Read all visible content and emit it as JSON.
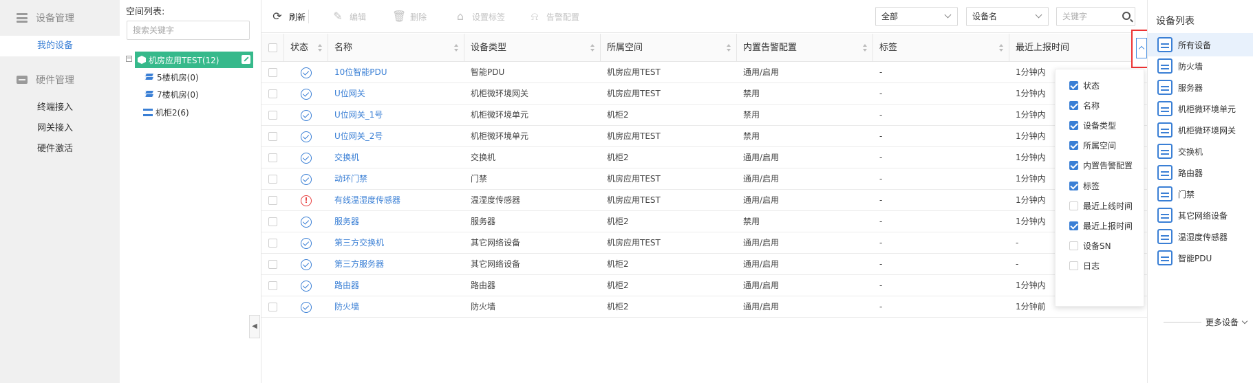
{
  "leftnav": {
    "group1": "设备管理",
    "group1_items": [
      "我的设备"
    ],
    "group2": "硬件管理",
    "group2_items": [
      "终端接入",
      "网关接入",
      "硬件激活"
    ]
  },
  "tree": {
    "title": "空间列表:",
    "search_placeholder": "搜索关键字",
    "root": "机房应用TEST(12)",
    "children": [
      "5楼机房(0)",
      "7楼机房(0)",
      "机柜2(6)"
    ]
  },
  "toolbar": {
    "refresh": "刷新",
    "edit": "编辑",
    "delete": "删除",
    "set_tag": "设置标签",
    "alarm_config": "告警配置",
    "filter1": "全部",
    "filter2": "设备名",
    "keyword_placeholder": "关键字"
  },
  "table": {
    "headers": [
      "状态",
      "名称",
      "设备类型",
      "所属空间",
      "内置告警配置",
      "标签",
      "最近上报时间"
    ],
    "rows": [
      {
        "status": "ok",
        "name": "10位智能PDU",
        "type": "智能PDU",
        "space": "机房应用TEST",
        "alarm": "通用/启用",
        "tag": "-",
        "report": "1分钟内"
      },
      {
        "status": "ok",
        "name": "U位网关",
        "type": "机柜微环境网关",
        "space": "机房应用TEST",
        "alarm": "禁用",
        "tag": "-",
        "report": "1分钟内"
      },
      {
        "status": "ok",
        "name": "U位网关_1号",
        "type": "机柜微环境单元",
        "space": "机柜2",
        "alarm": "禁用",
        "tag": "-",
        "report": "1分钟内"
      },
      {
        "status": "ok",
        "name": "U位网关_2号",
        "type": "机柜微环境单元",
        "space": "机房应用TEST",
        "alarm": "禁用",
        "tag": "-",
        "report": "1分钟内"
      },
      {
        "status": "ok",
        "name": "交换机",
        "type": "交换机",
        "space": "机柜2",
        "alarm": "通用/启用",
        "tag": "-",
        "report": "1分钟内"
      },
      {
        "status": "ok",
        "name": "动环门禁",
        "type": "门禁",
        "space": "机房应用TEST",
        "alarm": "通用/启用",
        "tag": "-",
        "report": "1分钟内"
      },
      {
        "status": "alarm",
        "name": "有线温湿度传感器",
        "type": "温湿度传感器",
        "space": "机房应用TEST",
        "alarm": "通用/启用",
        "tag": "-",
        "report": "1分钟内"
      },
      {
        "status": "ok",
        "name": "服务器",
        "type": "服务器",
        "space": "机柜2",
        "alarm": "禁用",
        "tag": "-",
        "report": "1分钟内"
      },
      {
        "status": "ok",
        "name": "第三方交换机",
        "type": "其它网络设备",
        "space": "机房应用TEST",
        "alarm": "通用/启用",
        "tag": "-",
        "report": "-"
      },
      {
        "status": "ok",
        "name": "第三方服务器",
        "type": "其它网络设备",
        "space": "机柜2",
        "alarm": "通用/启用",
        "tag": "-",
        "report": "-"
      },
      {
        "status": "ok",
        "name": "路由器",
        "type": "路由器",
        "space": "机柜2",
        "alarm": "通用/启用",
        "tag": "-",
        "report": "1分钟内"
      },
      {
        "status": "ok",
        "name": "防火墙",
        "type": "防火墙",
        "space": "机柜2",
        "alarm": "通用/启用",
        "tag": "-",
        "report": "1分钟前"
      }
    ]
  },
  "column_menu": [
    {
      "label": "状态",
      "checked": true
    },
    {
      "label": "名称",
      "checked": true
    },
    {
      "label": "设备类型",
      "checked": true
    },
    {
      "label": "所属空间",
      "checked": true
    },
    {
      "label": "内置告警配置",
      "checked": true
    },
    {
      "label": "标签",
      "checked": true
    },
    {
      "label": "最近上线时间",
      "checked": false
    },
    {
      "label": "最近上报时间",
      "checked": true
    },
    {
      "label": "设备SN",
      "checked": false
    },
    {
      "label": "日志",
      "checked": false
    }
  ],
  "device_panel": {
    "title": "设备列表",
    "items": [
      "所有设备",
      "防火墙",
      "服务器",
      "机柜微环境单元",
      "机柜微环境网关",
      "交换机",
      "路由器",
      "门禁",
      "其它网络设备",
      "温湿度传感器",
      "智能PDU"
    ],
    "more": "更多设备"
  },
  "colors": {
    "accent": "#3a7fd5",
    "tree_active": "#36b98b",
    "alarm": "#e84040",
    "highlight_box": "#e33"
  }
}
